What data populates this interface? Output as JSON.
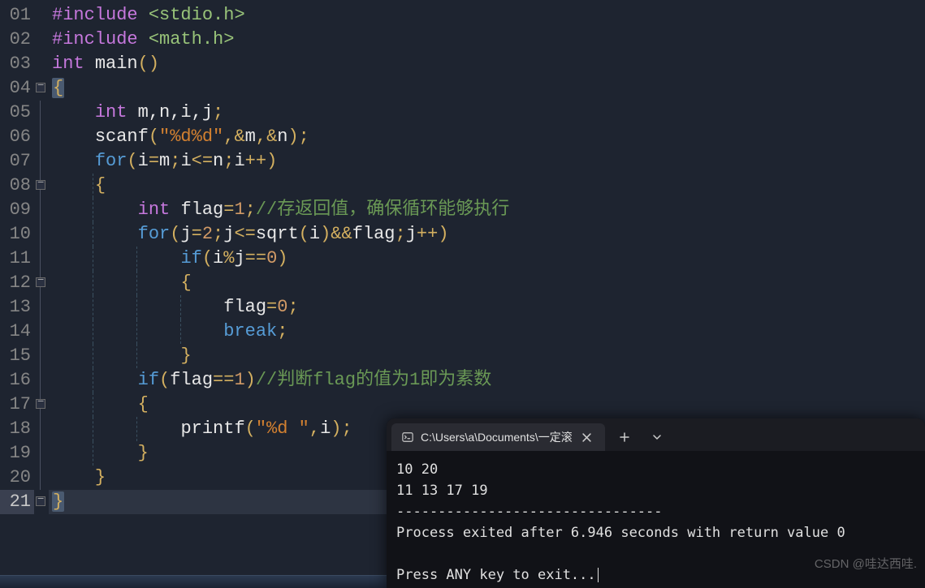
{
  "editor": {
    "line_numbers": [
      "01",
      "02",
      "03",
      "04",
      "05",
      "06",
      "07",
      "08",
      "09",
      "10",
      "11",
      "12",
      "13",
      "14",
      "15",
      "16",
      "17",
      "18",
      "19",
      "20",
      "21"
    ],
    "active_line_index": 20,
    "fold_markers": [
      3,
      7,
      11,
      16,
      20
    ],
    "lines": {
      "l1": {
        "pre": "#include ",
        "inc": "<stdio.h>"
      },
      "l2": {
        "pre": "#include ",
        "inc": "<math.h>"
      },
      "l3": {
        "type": "int",
        "sp": " ",
        "fn": "main",
        "paren": "()"
      },
      "l4": {
        "brace": "{"
      },
      "l5": {
        "indent": "    ",
        "type": "int",
        "sp": " ",
        "ids": "m,n,i,j",
        "semi": ";"
      },
      "l6": {
        "indent": "    ",
        "fn": "scanf",
        "open": "(",
        "str": "\"%d%d\"",
        "comma": ",",
        "amp1": "&",
        "id1": "m",
        "comma2": ",",
        "amp2": "&",
        "id2": "n",
        "close": ")",
        "semi": ";"
      },
      "l7": {
        "indent": "    ",
        "kw": "for",
        "open": "(",
        "a1": "i",
        "eq1": "=",
        "a2": "m",
        "semi1": ";",
        "b1": "i",
        "le": "<=",
        "b2": "n",
        "semi2": ";",
        "c1": "i",
        "inc": "++",
        "close": ")"
      },
      "l8": {
        "indent": "    ",
        "brace": "{"
      },
      "l9": {
        "indent": "        ",
        "type": "int",
        "sp": " ",
        "id": "flag",
        "eq": "=",
        "num": "1",
        "semi": ";",
        "cmt": "//存返回值，确保循环能够执行"
      },
      "l10": {
        "indent": "        ",
        "kw": "for",
        "open": "(",
        "a1": "j",
        "eq1": "=",
        "a2": "2",
        "semi1": ";",
        "b1": "j",
        "le": "<=",
        "fn": "sqrt",
        "po": "(",
        "pi": "i",
        "pc": ")",
        "and": "&&",
        "fl": "flag",
        "semi2": ";",
        "c1": "j",
        "inc": "++",
        "close": ")"
      },
      "l11": {
        "indent": "            ",
        "kw": "if",
        "open": "(",
        "a": "i",
        "mod": "%",
        "b": "j",
        "eqeq": "==",
        "z": "0",
        "close": ")"
      },
      "l12": {
        "indent": "            ",
        "brace": "{"
      },
      "l13": {
        "indent": "                ",
        "id": "flag",
        "eq": "=",
        "num": "0",
        "semi": ";"
      },
      "l14": {
        "indent": "                ",
        "kw": "break",
        "semi": ";"
      },
      "l15": {
        "indent": "            ",
        "brace": "}"
      },
      "l16": {
        "indent": "        ",
        "kw": "if",
        "open": "(",
        "id": "flag",
        "eqeq": "==",
        "num": "1",
        "close": ")",
        "cmt": "//判断flag的值为1即为素数"
      },
      "l17": {
        "indent": "        ",
        "brace": "{"
      },
      "l18": {
        "indent": "            ",
        "fn": "printf",
        "open": "(",
        "str": "\"%d \"",
        "comma": ",",
        "id": "i",
        "close": ")",
        "semi": ";"
      },
      "l19": {
        "indent": "        ",
        "brace": "}"
      },
      "l20": {
        "indent": "    ",
        "brace": "}"
      },
      "l21": {
        "brace": "}"
      }
    }
  },
  "terminal": {
    "tab_title": "C:\\Users\\a\\Documents\\一定滚",
    "output_line1": "10 20",
    "output_line2": "11 13 17 19",
    "separator": "--------------------------------",
    "status": "Process exited after 6.946 seconds with return value 0",
    "prompt": "Press ANY key to exit..."
  },
  "watermark": "CSDN @哇达西哇."
}
